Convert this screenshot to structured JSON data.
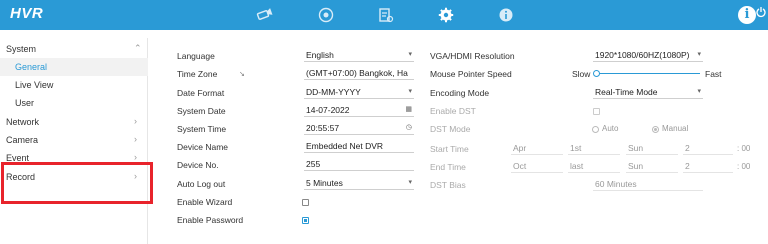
{
  "topbar": {
    "logo": "HVR",
    "icons": [
      "camera-icon",
      "playback-icon",
      "file-icon",
      "settings-icon",
      "info-icon"
    ],
    "right": {
      "info": "i",
      "power": "power-icon"
    },
    "accent": "#2a9ad6"
  },
  "sidebar": {
    "system": "System",
    "general": "General",
    "live_view": "Live View",
    "user": "User",
    "network": "Network",
    "camera": "Camera",
    "event": "Event",
    "record": "Record"
  },
  "left_form": {
    "language_label": "Language",
    "language_value": "English",
    "timezone_label": "Time Zone",
    "timezone_value": "(GMT+07:00) Bangkok, Ha",
    "date_format_label": "Date Format",
    "date_format_value": "DD-MM-YYYY",
    "system_date_label": "System Date",
    "system_date_value": "14-07-2022",
    "system_time_label": "System Time",
    "system_time_value": "20:55:57",
    "device_name_label": "Device Name",
    "device_name_value": "Embedded Net DVR",
    "device_no_label": "Device No.",
    "device_no_value": "255",
    "auto_logout_label": "Auto Log out",
    "auto_logout_value": "5 Minutes",
    "enable_wizard_label": "Enable Wizard",
    "enable_password_label": "Enable Password"
  },
  "right_form": {
    "vga_label": "VGA/HDMI Resolution",
    "vga_value": "1920*1080/60HZ(1080P)",
    "mouse_label": "Mouse Pointer Speed",
    "slow": "Slow",
    "fast": "Fast",
    "mouse_speed": 0.0,
    "encoding_label": "Encoding Mode",
    "encoding_value": "Real-Time Mode",
    "enable_dst_label": "Enable DST",
    "dst_mode_label": "DST Mode",
    "dst_auto": "Auto",
    "dst_manual": "Manual",
    "start_label": "Start Time",
    "start_month": "Apr",
    "start_week": "1st",
    "start_day": "Sun",
    "start_hour": "2",
    "start_min": ": 00",
    "end_label": "End Time",
    "end_month": "Oct",
    "end_week": "last",
    "end_day": "Sun",
    "end_hour": "2",
    "end_min": ": 00",
    "dst_bias_label": "DST Bias",
    "dst_bias_value": "60 Minutes"
  }
}
